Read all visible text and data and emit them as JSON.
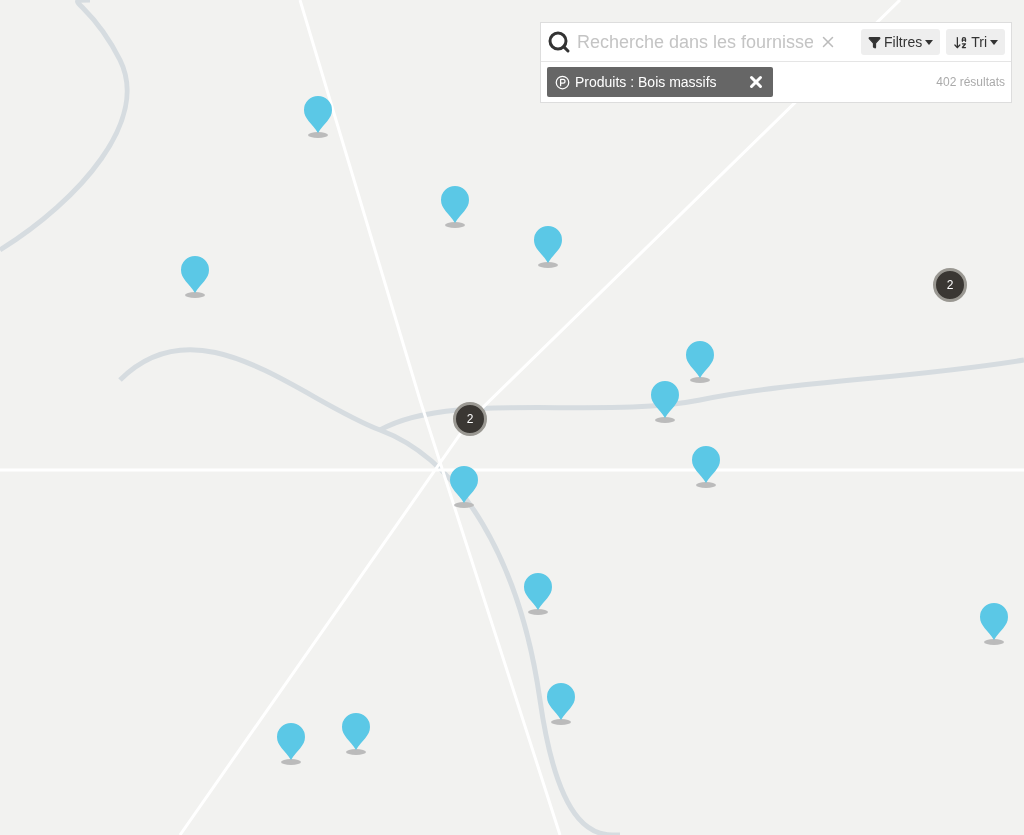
{
  "search": {
    "placeholder": "Recherche dans les fournisse"
  },
  "buttons": [
    {
      "kind": "filter",
      "label": "Filtres"
    },
    {
      "kind": "sort",
      "label": "Tri"
    }
  ],
  "active_filters": [
    {
      "label": "Produits : Bois massifs"
    }
  ],
  "result_count": "402 résultats",
  "markers": [
    {
      "kind": "pin"
    },
    {
      "kind": "pin"
    },
    {
      "kind": "pin"
    },
    {
      "kind": "pin"
    },
    {
      "kind": "pin"
    },
    {
      "kind": "pin"
    },
    {
      "kind": "pin"
    },
    {
      "kind": "pin"
    },
    {
      "kind": "pin"
    },
    {
      "kind": "pin"
    },
    {
      "kind": "pin"
    },
    {
      "kind": "pin"
    },
    {
      "kind": "pin"
    },
    {
      "kind": "cluster",
      "count": "2"
    },
    {
      "kind": "cluster",
      "count": "2"
    }
  ]
}
